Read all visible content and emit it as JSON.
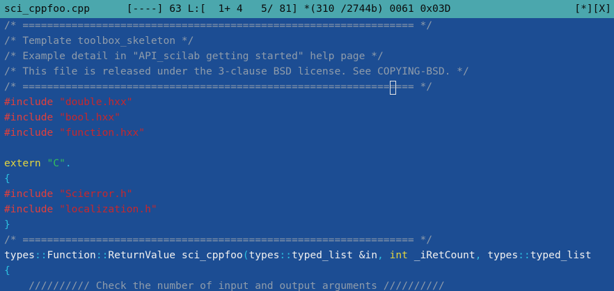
{
  "status": {
    "left": "sci_cppfoo.cpp      [----] 63 L:[  1+ 4   5/ 81] *(310 /2744b) 0061 0x03D",
    "right": "[*][X]"
  },
  "colors": {
    "background": "#1c4d93",
    "status_bg": "#4ba7ad",
    "comment": "#8f9cab",
    "directive": "#e23f3b",
    "string_red": "#c8272c",
    "string_green": "#33bf5c",
    "keyword": "#e3d53f",
    "text": "#f0f0f0",
    "punct": "#2dc0e0"
  },
  "cursor": {
    "line": 5,
    "col": 63
  },
  "lines": [
    [
      {
        "t": "/* ================================================================ */",
        "c": "comment"
      }
    ],
    [
      {
        "t": "/* Template toolbox_skeleton */",
        "c": "comment"
      }
    ],
    [
      {
        "t": "/* Example detail in \"API_scilab getting started\" help page */",
        "c": "comment"
      }
    ],
    [
      {
        "t": "/* This file is released under the 3-clause BSD license. See COPYING-BSD. */",
        "c": "comment"
      }
    ],
    [
      {
        "t": "/* ================================================================ */",
        "c": "comment"
      }
    ],
    [
      {
        "t": "#include ",
        "c": "directive"
      },
      {
        "t": "\"double.hxx\"",
        "c": "string-red"
      }
    ],
    [
      {
        "t": "#include ",
        "c": "directive"
      },
      {
        "t": "\"bool.hxx\"",
        "c": "string-red"
      }
    ],
    [
      {
        "t": "#include ",
        "c": "directive"
      },
      {
        "t": "\"function.hxx\"",
        "c": "string-red"
      }
    ],
    [],
    [
      {
        "t": "extern ",
        "c": "keyword"
      },
      {
        "t": "\"C\"",
        "c": "string-green"
      },
      {
        "t": ".",
        "c": "punct"
      }
    ],
    [
      {
        "t": "{",
        "c": "punct"
      }
    ],
    [
      {
        "t": "#include ",
        "c": "directive"
      },
      {
        "t": "\"Scierror.h\"",
        "c": "string-red"
      }
    ],
    [
      {
        "t": "#include ",
        "c": "directive"
      },
      {
        "t": "\"localization.h\"",
        "c": "string-red"
      }
    ],
    [
      {
        "t": "}",
        "c": "punct"
      }
    ],
    [
      {
        "t": "/* ================================================================ */",
        "c": "comment"
      }
    ],
    [
      {
        "t": "types",
        "c": "text"
      },
      {
        "t": "::",
        "c": "punct"
      },
      {
        "t": "Function",
        "c": "text"
      },
      {
        "t": "::",
        "c": "punct"
      },
      {
        "t": "ReturnValue sci_cppfoo",
        "c": "text"
      },
      {
        "t": "(",
        "c": "punct"
      },
      {
        "t": "types",
        "c": "text"
      },
      {
        "t": "::",
        "c": "punct"
      },
      {
        "t": "typed_list &in",
        "c": "text"
      },
      {
        "t": ", ",
        "c": "punct"
      },
      {
        "t": "int",
        "c": "keyword"
      },
      {
        "t": " _iRetCount",
        "c": "text"
      },
      {
        "t": ", ",
        "c": "punct"
      },
      {
        "t": "types",
        "c": "text"
      },
      {
        "t": "::",
        "c": "punct"
      },
      {
        "t": "typed_list",
        "c": "text"
      }
    ],
    [
      {
        "t": "{",
        "c": "punct"
      }
    ],
    [
      {
        "t": "    ////////// Check the number of input and output arguments //////////",
        "c": "comment"
      }
    ]
  ]
}
